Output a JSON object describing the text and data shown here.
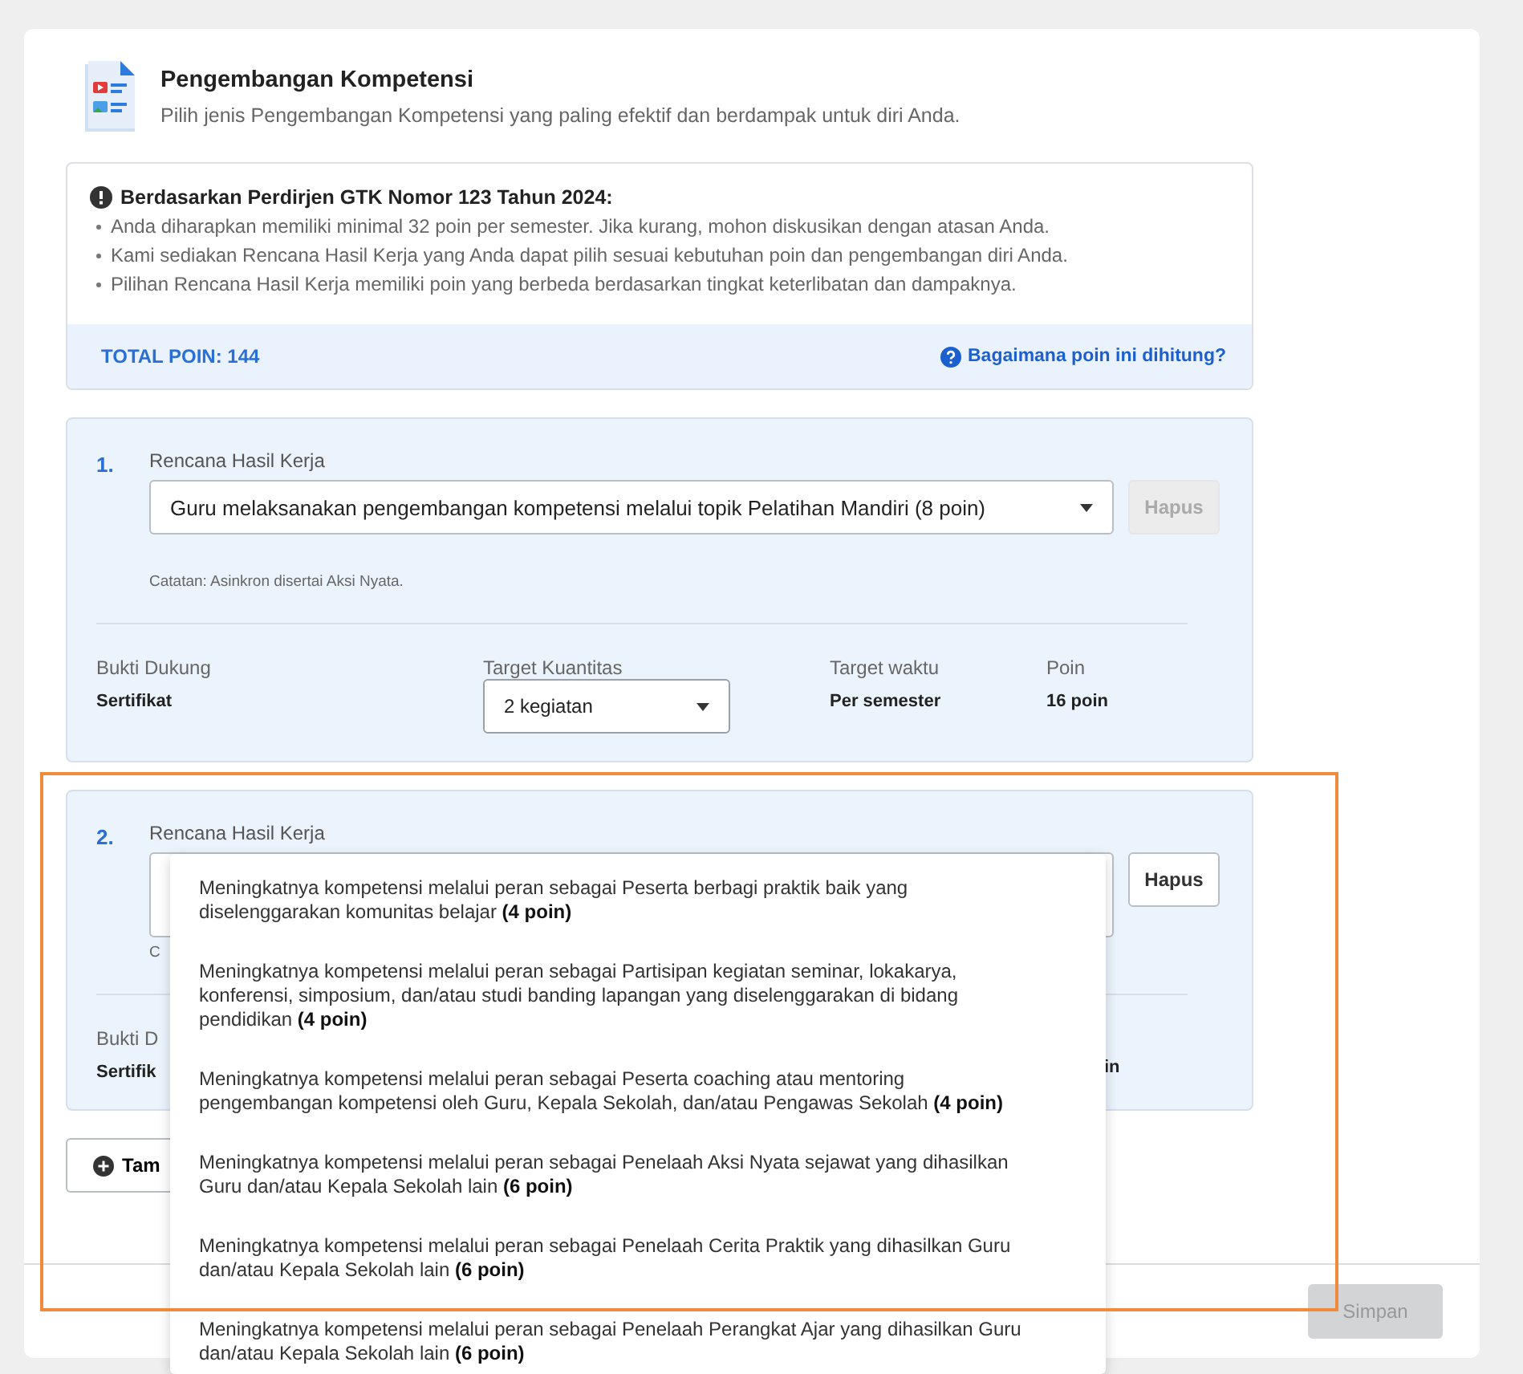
{
  "header": {
    "title": "Pengembangan Kompetensi",
    "subtitle": "Pilih jenis Pengembangan Kompetensi yang paling efektif dan berdampak untuk diri Anda."
  },
  "notice": {
    "title": "Berdasarkan Perdirjen GTK Nomor 123 Tahun 2024:",
    "bullets": [
      "Anda diharapkan memiliki minimal 32 poin per semester. Jika kurang, mohon diskusikan dengan atasan Anda.",
      "Kami sediakan Rencana Hasil Kerja yang Anda dapat pilih sesuai kebutuhan poin dan pengembangan diri Anda.",
      "Pilihan Rencana Hasil Kerja memiliki poin yang berbeda berdasarkan tingkat keterlibatan dan dampaknya."
    ],
    "total": "TOTAL POIN: 144",
    "help_link": "Bagaimana poin ini dihitung?"
  },
  "plans": [
    {
      "number": "1.",
      "label": "Rencana Hasil Kerja",
      "value": "Guru melaksanakan pengembangan kompetensi melalui topik Pelatihan Mandiri (8 poin)",
      "delete_button": "Hapus",
      "delete_disabled": true,
      "note": "Catatan: Asinkron disertai Aksi Nyata.",
      "expanded": false,
      "details": [
        {
          "kind": "text",
          "label": "Bukti Dukung",
          "value": "Sertifikat"
        },
        {
          "kind": "select",
          "label": "Target Kuantitas",
          "value": "2 kegiatan"
        },
        {
          "kind": "text",
          "label": "Target waktu",
          "value": "Per semester"
        },
        {
          "kind": "text",
          "label": "Poin",
          "value": "16 poin"
        }
      ]
    },
    {
      "number": "2.",
      "label": "Rencana Hasil Kerja",
      "delete_button": "Hapus",
      "delete_disabled": false,
      "note": "C",
      "expanded": true,
      "details": [
        {
          "kind": "text",
          "label": "Bukti D",
          "value": "Sertifik"
        },
        {
          "kind": "tail",
          "value": "in"
        }
      ],
      "options": [
        {
          "text": "Meningkatnya kompetensi melalui peran sebagai Peserta berbagi praktik baik yang diselenggarakan komunitas belajar **(4 poin)**"
        },
        {
          "text": "Meningkatnya kompetensi melalui peran sebagai Partisipan kegiatan seminar, lokakarya, konferensi, simposium, dan/atau studi banding lapangan yang diselenggarakan di bidang pendidikan **(4 poin)**"
        },
        {
          "text": "Meningkatnya kompetensi melalui peran sebagai Peserta coaching atau mentoring pengembangan kompetensi oleh Guru, Kepala Sekolah, dan/atau Pengawas Sekolah **(4 poin)**"
        },
        {
          "text": "Meningkatnya kompetensi melalui peran sebagai Penelaah Aksi Nyata sejawat yang dihasilkan Guru dan/atau Kepala Sekolah lain **(6 poin)**"
        },
        {
          "text": "Meningkatnya kompetensi melalui peran sebagai Penelaah Cerita Praktik yang dihasilkan Guru dan/atau Kepala Sekolah lain **(6 poin)**"
        },
        {
          "text": "Meningkatnya kompetensi melalui peran sebagai Penelaah Perangkat Ajar yang dihasilkan Guru dan/atau Kepala Sekolah lain **(6 poin)**"
        }
      ]
    }
  ],
  "add_button": "Tam",
  "save_button": {
    "label": "Simpan",
    "disabled": true
  }
}
